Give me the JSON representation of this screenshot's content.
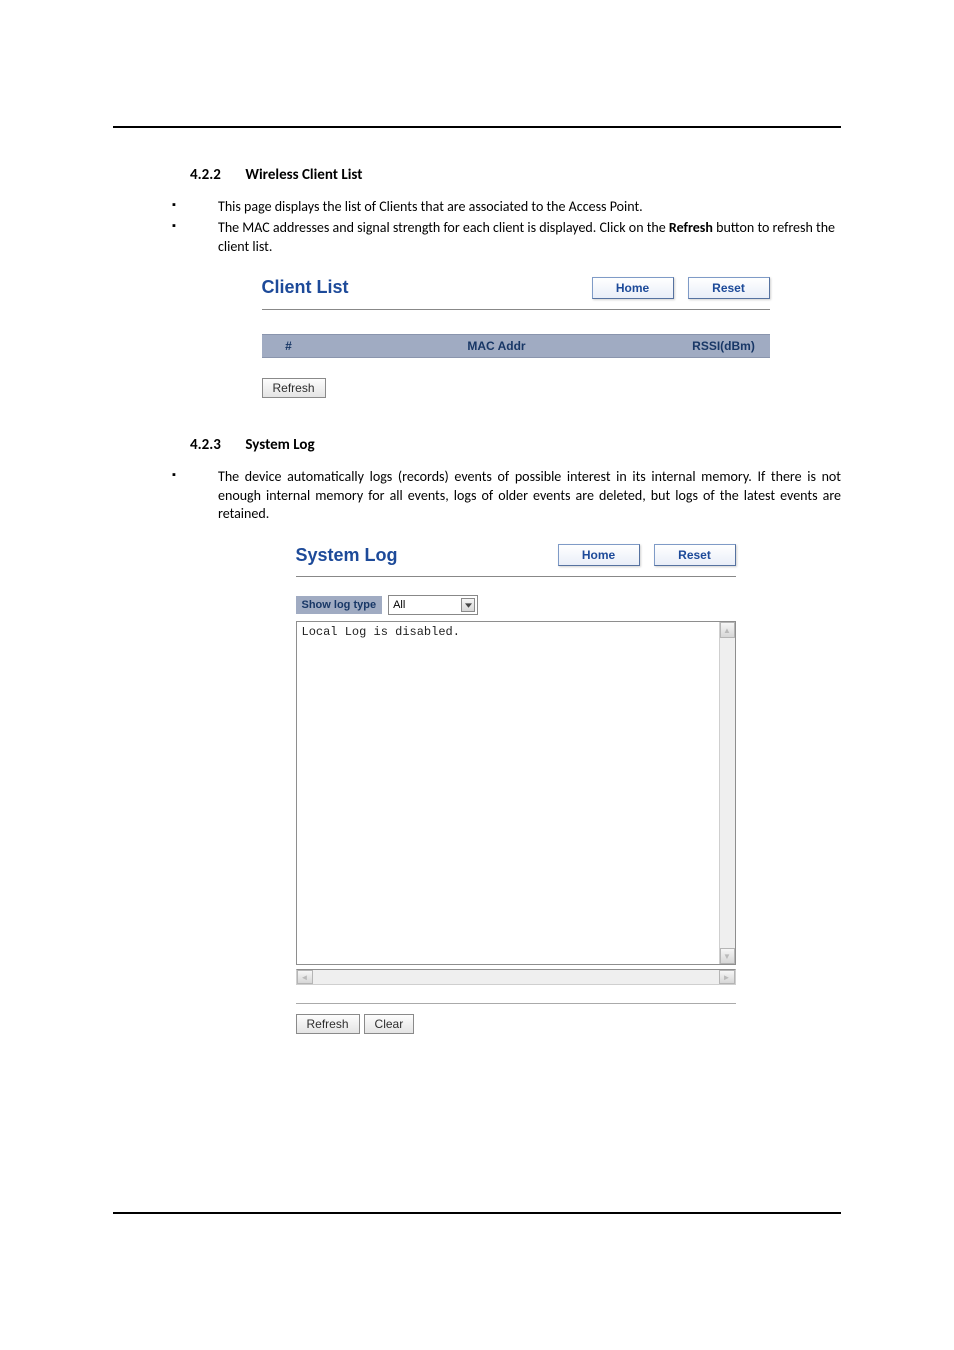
{
  "sections": {
    "s422": {
      "number": "4.2.2",
      "title": "Wireless Client List",
      "bullets": [
        "This page displays the list of Clients that are associated to the Access Point.",
        "The MAC addresses and signal strength for each client is displayed. Click on the Refresh button to refresh the client list."
      ]
    },
    "s423": {
      "number": "4.2.3",
      "title": "System Log",
      "bullets": [
        "The device automatically logs (records) events of possible interest in its internal memory. If there is not enough internal memory for all events, logs of older events are deleted, but logs of the latest events are retained."
      ]
    }
  },
  "client_list": {
    "panel_title": "Client List",
    "home_label": "Home",
    "reset_label": "Reset",
    "columns": {
      "num": "#",
      "mac": "MAC Addr",
      "rssi": "RSSI(dBm)"
    },
    "refresh_label": "Refresh"
  },
  "system_log": {
    "panel_title": "System Log",
    "home_label": "Home",
    "reset_label": "Reset",
    "show_label": "Show log type",
    "select_value": "All",
    "log_text": "Local Log is disabled.",
    "refresh_label": "Refresh",
    "clear_label": "Clear"
  },
  "bold_word": "Refresh"
}
